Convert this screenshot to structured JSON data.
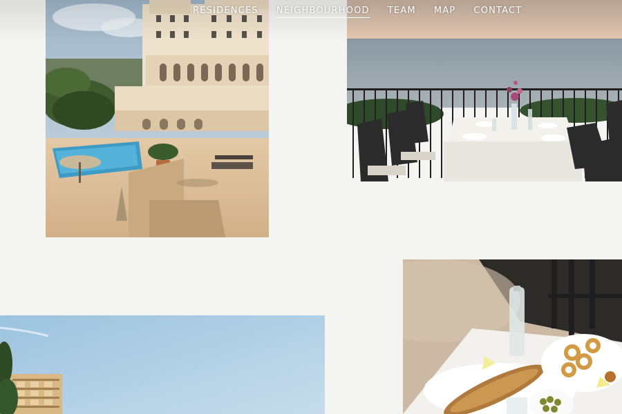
{
  "navigation": {
    "items": [
      {
        "label": "RESIDENCES",
        "active": false
      },
      {
        "label": "NEIGHBOURHOOD",
        "active": true
      },
      {
        "label": "TEAM",
        "active": false
      },
      {
        "label": "MAP",
        "active": false
      },
      {
        "label": "CONTACT",
        "active": false
      }
    ]
  },
  "colors": {
    "page_background": "#f4f4f3",
    "nav_text": "#ffffff"
  },
  "gallery": {
    "photos": [
      {
        "name": "hotel-terrace-photo",
        "subject": "hotel building with pool and terrace"
      },
      {
        "name": "sea-view-dining-photo",
        "subject": "dining table on balcony overlooking sea"
      },
      {
        "name": "seafood-plate-photo",
        "subject": "grilled fish, calamari and olives on table"
      },
      {
        "name": "coastal-buildings-photo",
        "subject": "apartment buildings under blue sky"
      }
    ]
  }
}
